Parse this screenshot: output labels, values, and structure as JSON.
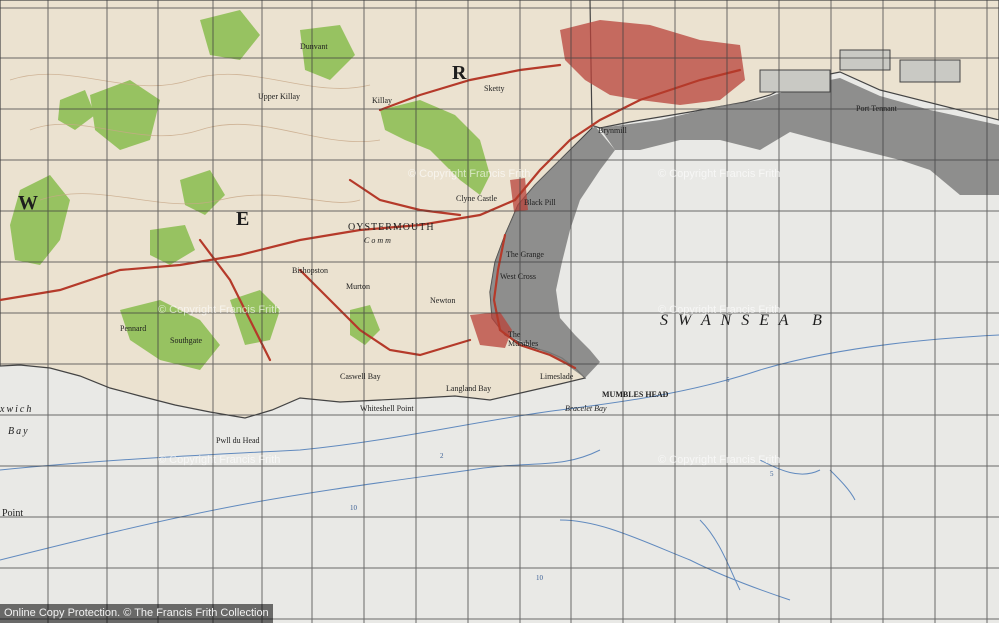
{
  "map": {
    "sea_name": "S W A N S E A   B",
    "letters": {
      "r": "R",
      "e": "E",
      "w": "W"
    },
    "places": {
      "swansea_bay_west": "Bay",
      "xwich": "xwich",
      "point": "Point",
      "oystermouth": "OYSTERMOUTH",
      "common": "Comm",
      "the_mumbles": "The Mumbles",
      "mumbles_head": "MUMBLES HEAD",
      "bracelet_bay": "Bracelet Bay",
      "whiteshell_point": "Whiteshell Point",
      "pwll_du_head": "Pwll du Head",
      "black_pill": "Black Pill",
      "port_tennant": "Port Tennant",
      "brynmill": "Brynmill",
      "the_grange": "The Grange",
      "west_cross": "West Cross",
      "dunvant": "Dunvant",
      "killay": "Killay",
      "bishopston": "Bishopston",
      "murton": "Murton",
      "newton": "Newton",
      "caswell_bay": "Caswell Bay",
      "langland_bay": "Langland Bay",
      "limeslade": "Limeslade",
      "southgate": "Southgate",
      "pennard": "Pennard",
      "sketty": "Sketty",
      "clyne_castle": "Clyne Castle",
      "upper_killay": "Upper Killay"
    },
    "depth_labels": [
      "5",
      "2",
      "10",
      "10",
      "5"
    ]
  },
  "watermarks": [
    "© Copyright Francis Frith",
    "© Copyright Francis Frith",
    "© Copyright Francis Frith",
    "© Copyright Francis Frith",
    "© Copyright Francis Frith",
    "© Copyright Francis Frith"
  ],
  "footer": {
    "text": "Online Copy Protection.  © The Francis Frith Collection"
  },
  "colors": {
    "sea": "#e9e9e6",
    "land": "#ebe2d0",
    "woodland": "#8fbf55",
    "foreshore": "#7e7e7c",
    "roads": "#b53a2a",
    "grid": "#3f3f3f",
    "town": "#b8413a"
  }
}
